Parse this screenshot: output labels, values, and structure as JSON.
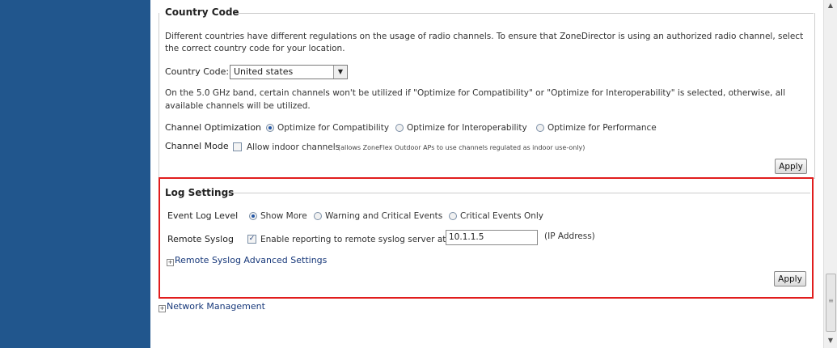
{
  "country": {
    "heading": "Country Code",
    "description_line1": "Different countries have different regulations on the usage of radio channels. To ensure that ZoneDirector is using an authorized radio channel, select",
    "description_line2": "the correct country code for your location.",
    "country_code_label": "Country Code:",
    "country_code_value": "United states",
    "band_note_line1": "On the 5.0 GHz band, certain channels won't be utilized if \"Optimize for Compatibility\" or \"Optimize for Interoperability\" is selected, otherwise, all",
    "band_note_line2": "available channels will be utilized.",
    "optimization_label": "Channel Optimization",
    "opt_compat": "Optimize for Compatibility",
    "opt_interop": "Optimize for Interoperability",
    "opt_perf": "Optimize for Performance",
    "selected_optimization": "Optimize for Compatibility",
    "mode_label": "Channel Mode",
    "mode_checkbox_label": "Allow indoor channels",
    "mode_checkbox_note": "(allows ZoneFlex Outdoor APs to use channels regulated as indoor use-only)",
    "mode_checked": false,
    "apply_label": "Apply"
  },
  "log": {
    "heading": "Log Settings",
    "event_level_label": "Event Log Level",
    "level_show_more": "Show More",
    "level_warning": "Warning and Critical Events",
    "level_critical": "Critical Events Only",
    "selected_level": "Show More",
    "remote_syslog_label": "Remote Syslog",
    "syslog_checkbox_label": "Enable reporting to remote syslog server at",
    "syslog_checked": true,
    "syslog_ip": "10.1.1.5",
    "ip_hint": "(IP Address)",
    "advanced_link": "Remote Syslog Advanced Settings",
    "apply_label": "Apply"
  },
  "network_management_link": "Network Management",
  "colors": {
    "sidebar": "#21568d",
    "highlight_border": "#e11d1d",
    "link": "#17387a"
  }
}
